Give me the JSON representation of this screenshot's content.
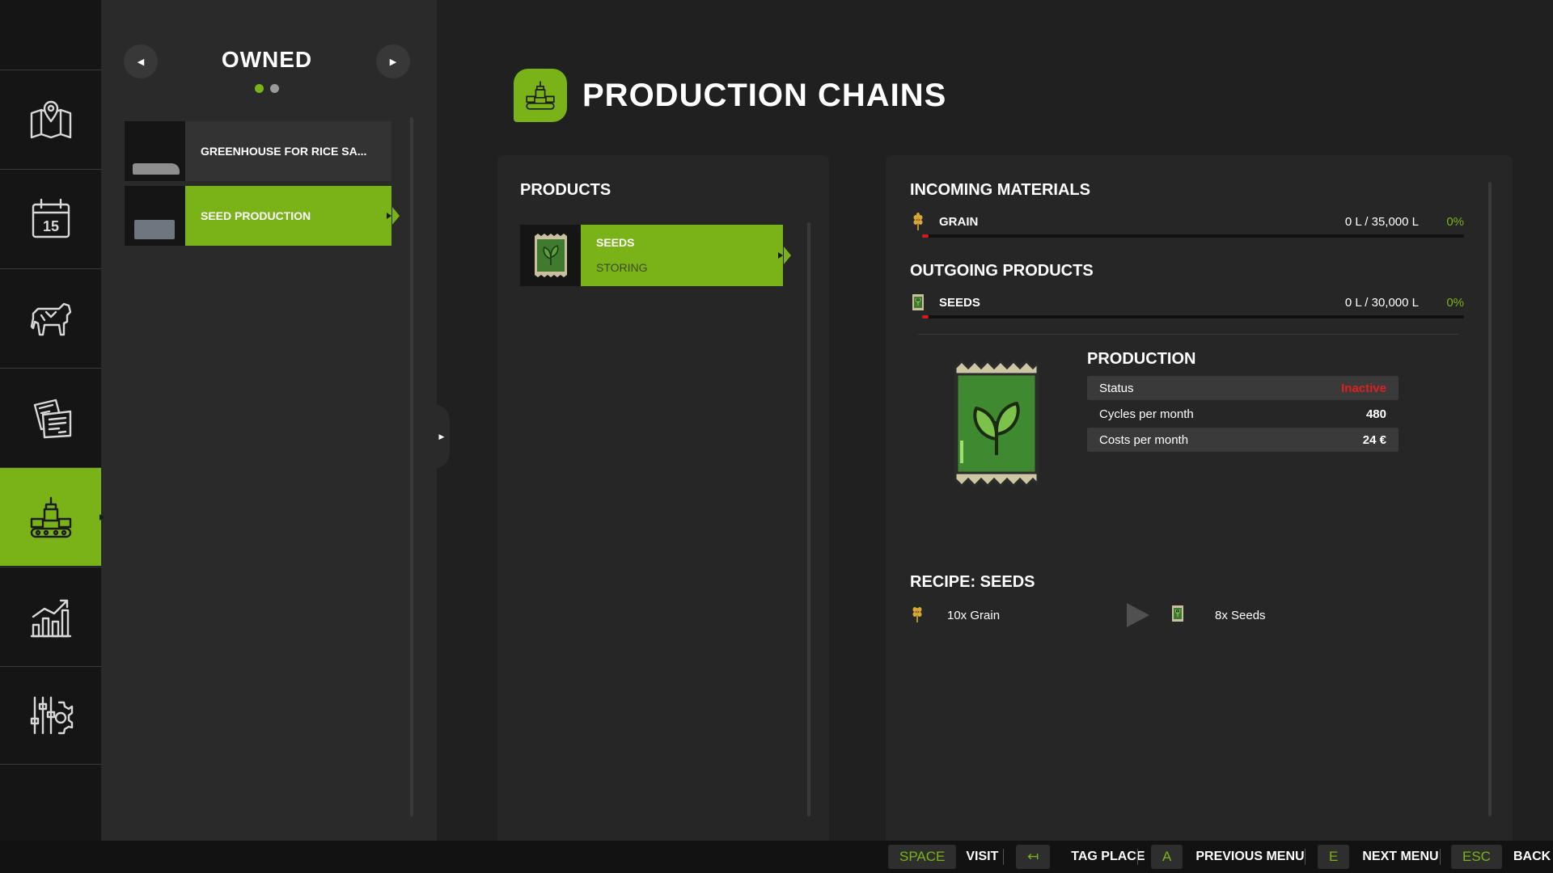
{
  "rail": {
    "items": [
      {
        "name": "map",
        "icon": "map-pin-icon",
        "active": false
      },
      {
        "name": "calendar",
        "icon": "calendar-icon",
        "label": "15",
        "active": false
      },
      {
        "name": "animals",
        "icon": "cow-icon",
        "active": false
      },
      {
        "name": "contracts",
        "icon": "contracts-icon",
        "active": false
      },
      {
        "name": "production",
        "icon": "production-icon",
        "active": true
      },
      {
        "name": "statistics",
        "icon": "chart-icon",
        "active": false
      },
      {
        "name": "settings",
        "icon": "settings-icon",
        "active": false
      }
    ]
  },
  "owned": {
    "title": "OWNED",
    "items": [
      {
        "label": "GREENHOUSE FOR RICE SA...",
        "active": false
      },
      {
        "label": "SEED PRODUCTION",
        "active": true
      }
    ]
  },
  "header": {
    "title": "PRODUCTION CHAINS"
  },
  "products": {
    "title": "PRODUCTS",
    "items": [
      {
        "name": "SEEDS",
        "status": "STORING"
      }
    ]
  },
  "incoming": {
    "title": "INCOMING MATERIALS",
    "items": [
      {
        "name": "GRAIN",
        "amount": "0 L / 35,000 L",
        "percent": "0%",
        "fill": 0
      }
    ]
  },
  "outgoing": {
    "title": "OUTGOING PRODUCTS",
    "items": [
      {
        "name": "SEEDS",
        "amount": "0 L / 30,000 L",
        "percent": "0%",
        "fill": 0
      }
    ]
  },
  "production": {
    "title": "PRODUCTION",
    "stats": [
      {
        "label": "Status",
        "value": "Inactive"
      },
      {
        "label": "Cycles per month",
        "value": "480"
      },
      {
        "label": "Costs per month",
        "value": "24 €"
      }
    ]
  },
  "recipe": {
    "title": "RECIPE: SEEDS",
    "input": "10x Grain",
    "output": "8x Seeds"
  },
  "footer": {
    "actions": [
      {
        "key": "SPACE",
        "label": "VISIT"
      },
      {
        "key": "↤",
        "label": "TAG PLACE"
      },
      {
        "key": "A",
        "label": "PREVIOUS MENU"
      },
      {
        "key": "E",
        "label": "NEXT MENU"
      },
      {
        "key": "ESC",
        "label": "BACK"
      }
    ]
  },
  "colors": {
    "accent": "#7ab317",
    "inactive": "#e02020",
    "bar_low": "#d41c1c"
  }
}
